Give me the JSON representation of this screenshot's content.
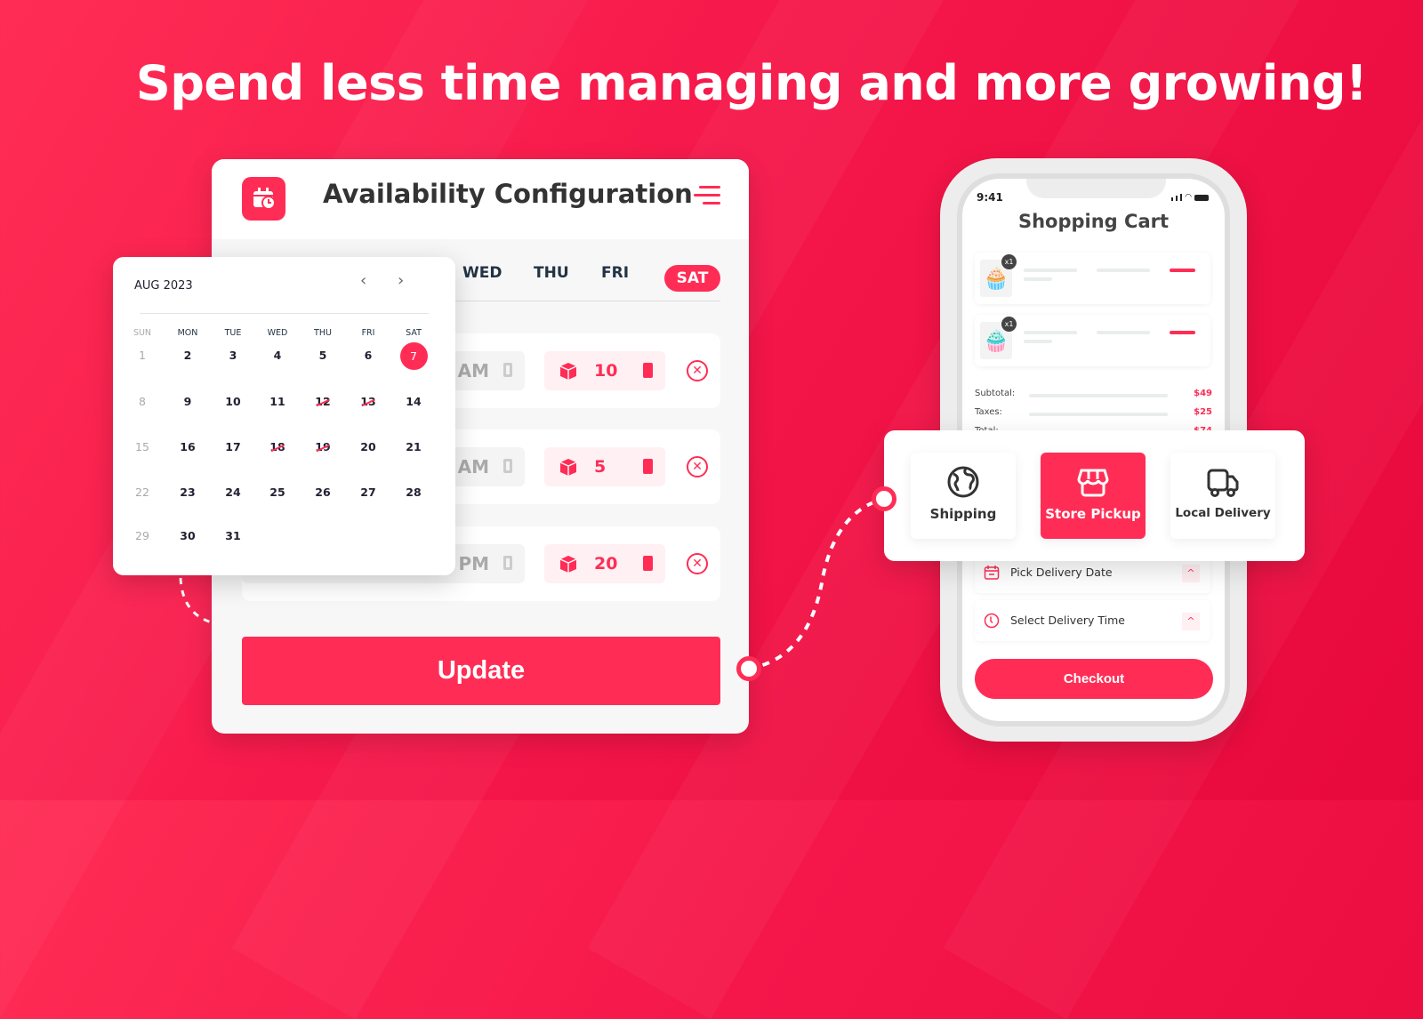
{
  "headline": "Spend less time managing and more growing!",
  "colors": {
    "accent": "#ff2d55",
    "background": "#f5174a"
  },
  "config": {
    "icon": "calendar-clock-icon",
    "title": "Availability Configuration",
    "menu_icon": "hamburger-menu-icon",
    "tabs": [
      "WED",
      "THU",
      "FRI",
      "SAT"
    ],
    "active_tab": "SAT",
    "rows": [
      {
        "time": "0 AM",
        "quantity": "10"
      },
      {
        "time": "0 AM",
        "quantity": "5"
      },
      {
        "time": "PM",
        "quantity": "20"
      }
    ],
    "update_label": "Update"
  },
  "calendar": {
    "month": "AUG 2023",
    "weekdays": [
      "SUN",
      "MON",
      "TUE",
      "WED",
      "THU",
      "FRI",
      "SAT"
    ],
    "selected": 7,
    "unavailable": [
      12,
      13,
      18,
      19
    ],
    "days": [
      1,
      2,
      3,
      4,
      5,
      6,
      7,
      8,
      9,
      10,
      11,
      12,
      13,
      14,
      15,
      16,
      17,
      18,
      19,
      20,
      21,
      22,
      23,
      24,
      25,
      26,
      27,
      28,
      29,
      30,
      31
    ]
  },
  "phone": {
    "time": "9:41",
    "title": "Shopping Cart",
    "items": [
      {
        "qty": "x1",
        "image": "blue-cupcake"
      },
      {
        "qty": "x1",
        "image": "pink-cupcake"
      }
    ],
    "summary": [
      {
        "label": "Subtotal:",
        "value": "$49"
      },
      {
        "label": "Taxes:",
        "value": "$25"
      },
      {
        "label": "Total:",
        "value": "$74"
      }
    ],
    "pick_date": "Pick Delivery Date",
    "select_time": "Select Delivery Time",
    "checkout": "Checkout"
  },
  "delivery_options": [
    {
      "label": "Shipping",
      "icon": "globe-icon",
      "active": false
    },
    {
      "label": "Store Pickup",
      "icon": "store-icon",
      "active": true
    },
    {
      "label": "Local Delivery",
      "icon": "truck-icon",
      "active": false
    }
  ]
}
